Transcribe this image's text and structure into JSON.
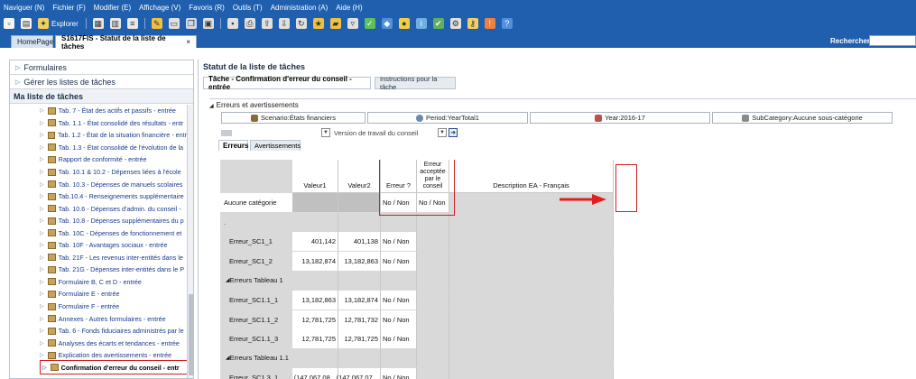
{
  "menu": [
    "Naviguer (N)",
    "Fichier (F)",
    "Modifier (E)",
    "Affichage (V)",
    "Favoris (R)",
    "Outils (T)",
    "Administration (A)",
    "Aide (H)"
  ],
  "toolbar": {
    "explorer_label": "Explorer"
  },
  "tabs": {
    "home": "HomePage",
    "active": "S1617FIS - Statut de la liste de tâches",
    "close": "×"
  },
  "search": {
    "label": "Rechercher:",
    "value": ""
  },
  "left": {
    "formulaires": "Formulaires",
    "gerer": "Gérer les listes de tâches",
    "ma_liste": "Ma liste de tâches",
    "items": [
      "Tab. 7 - État des actifs et passifs - entrée",
      "Tab. 1.1 - État consolidé des résultats - entr",
      "Tab. 1.2 - État de la situation financière - entr",
      "Tab. 1.3 - État consolidé de l'évolution de la",
      "Rapport de conformité - entrée",
      "Tab. 10.1 & 10.2 - Dépenses liées à l'école",
      "Tab. 10.3 - Dépenses de manuels scolaires",
      "Tab.10.4 - Renseignements supplémentaire",
      "Tab. 10.6 - Dépenses d'admin. du conseil -",
      "Tab. 10.8 - Dépenses supplémentaires du p",
      "Tab. 10C - Dépenses de fonctionnement et",
      "Tab. 10F - Avantages sociaux - entrée",
      "Tab. 21F - Les revenus inter-entités dans le",
      "Tab. 21G - Dépenses inter-entités dans le P",
      "Formulaire B, C et D - entrée",
      "Formulaire E - entrée",
      "Formulaire F - entrée",
      "Annexes - Autres formulaires - entrée",
      "Tab. 6 - Fonds fiduciaires administrés par le",
      "Analyses des écarts et tendances - entrée",
      "Explication des avertissements - entrée",
      "Confirmation d'erreur du conseil - entr"
    ]
  },
  "right": {
    "title": "Statut de la liste de tâches",
    "tab_on": "Tâche - Confirmation d'erreur du conseil - entrée",
    "tab_off": "Instructions pour la tâche",
    "section": "Erreurs et avertissements",
    "pov": {
      "scenario": "Scenario:États financiers",
      "period": "Period:YearTotal1",
      "year": "Year:2016-17",
      "subcategory": "SubCategory:Aucune sous-catégorie"
    },
    "version_left": "",
    "version_label": "Version de travail du conseil",
    "grid_tab_on": "Erreurs",
    "grid_tab_off": "Avertissements",
    "headers": {
      "valeur1": "Valeur1",
      "valeur2": "Valeur2",
      "erreur": "Erreur ?",
      "acceptee": "Erreur acceptée par le conseil",
      "description": "Description EA - Français"
    },
    "rows": [
      {
        "label": "Aucune catégorie",
        "v1": "",
        "v2": "",
        "e": "No / Non",
        "a": "No / Non"
      },
      {
        "label": ".",
        "v1": "",
        "v2": "",
        "e": "",
        "a": ""
      },
      {
        "label": "Erreur_SC1_1",
        "v1": "401,142",
        "v2": "401,138",
        "e": "No / Non",
        "a": ""
      },
      {
        "label": "Erreur_SC1_2",
        "v1": "13,182,874",
        "v2": "13,182,863",
        "e": "No / Non",
        "a": ""
      },
      {
        "label": "Erreurs Tableau 1",
        "v1": "",
        "v2": "",
        "e": "",
        "a": ""
      },
      {
        "label": "Erreur_SC1.1_1",
        "v1": "13,182,863",
        "v2": "13,182,874",
        "e": "No / Non",
        "a": ""
      },
      {
        "label": "Erreur_SC1.1_2",
        "v1": "12,781,725",
        "v2": "12,781,732",
        "e": "No / Non",
        "a": ""
      },
      {
        "label": "Erreur_SC1.1_3",
        "v1": "12,781,725",
        "v2": "12,781,725",
        "e": "No / Non",
        "a": ""
      },
      {
        "label": "Erreurs Tableau 1.1",
        "v1": "",
        "v2": "",
        "e": "",
        "a": ""
      },
      {
        "label": "Erreur_SC1.3_1",
        "v1": "(147,067,08...",
        "v2": "(147,067,07...",
        "e": "No / Non",
        "a": ""
      }
    ]
  },
  "colors": {
    "menubar": "#1f5fae",
    "highlight": "#d02020"
  }
}
